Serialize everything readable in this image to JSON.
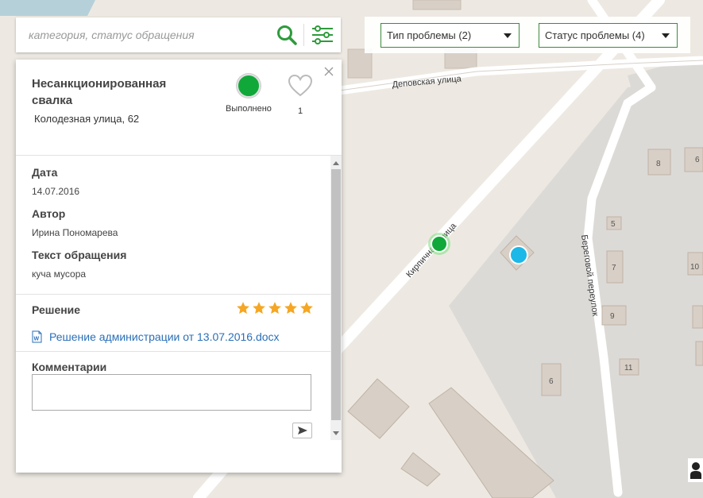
{
  "search": {
    "placeholder": "категория, статус обращения"
  },
  "filters": {
    "problem_type": "Тип проблемы (2)",
    "problem_status": "Статус проблемы (4)"
  },
  "map": {
    "streets": [
      "Деповская улица",
      "Кирпичная улица",
      "Береговой переулок"
    ],
    "house_numbers": [
      "8",
      "6",
      "5",
      "7",
      "10",
      "9",
      "11",
      "6"
    ]
  },
  "card": {
    "title": "Несанкционированная свалка",
    "address": "Колодезная улица, 62",
    "status_label": "Выполнено",
    "status_color": "#11a83a",
    "likes": "1",
    "date_label": "Дата",
    "date_value": "14.07.2016",
    "author_label": "Автор",
    "author_value": "Ирина Пономарева",
    "text_label": "Текст обращения",
    "text_value": "куча мусора",
    "decision_label": "Решение",
    "rating": 5,
    "document_link": "Решение администрации от 13.07.2016.docx",
    "comments_label": "Комментарии",
    "comment_value": ""
  },
  "colors": {
    "accent_green": "#3c8a3c",
    "marker_green": "#11a83a",
    "marker_blue": "#1cb8e8",
    "star": "#f5a623",
    "link": "#2a6fb8"
  }
}
